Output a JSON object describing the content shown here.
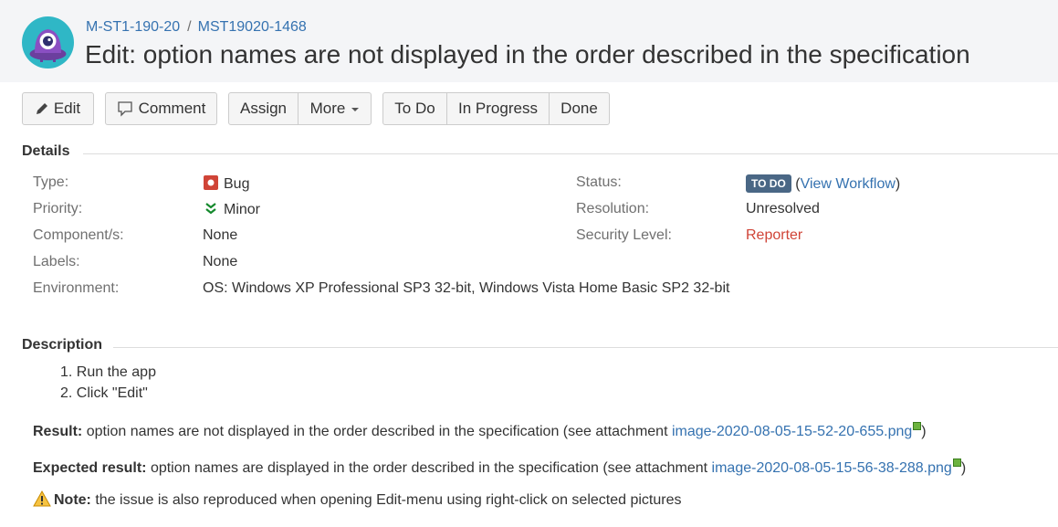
{
  "breadcrumb": {
    "project": "M-ST1-190-20",
    "separator": "/",
    "issue_key": "MST19020-1468"
  },
  "title": "Edit: option names are not displayed in the order described in the specification",
  "toolbar": {
    "edit": "Edit",
    "comment": "Comment",
    "assign": "Assign",
    "more": "More",
    "todo": "To Do",
    "in_progress": "In Progress",
    "done": "Done"
  },
  "details": {
    "heading": "Details",
    "type_label": "Type:",
    "type_value": "Bug",
    "priority_label": "Priority:",
    "priority_value": "Minor",
    "component_label": "Component/s:",
    "component_value": "None",
    "labels_label": "Labels:",
    "labels_value": "None",
    "environment_label": "Environment:",
    "environment_value": "OS: Windows XP Professional SP3 32-bit, Windows Vista Home Basic SP2 32-bit",
    "status_label": "Status:",
    "status_value": "TO DO",
    "status_paren_open": "(",
    "view_workflow": "View Workflow",
    "status_paren_close": ")",
    "resolution_label": "Resolution:",
    "resolution_value": "Unresolved",
    "security_label": "Security Level:",
    "security_value": "Reporter"
  },
  "description": {
    "heading": "Description",
    "steps": [
      "1. Run the app",
      "2. Click \"Edit\""
    ],
    "result_label": "Result:",
    "result_text": "option names are not displayed in the order described in the specification (see attachment",
    "result_link": "image-2020-08-05-15-52-20-655.png",
    "close_paren": ")",
    "expected_label": "Expected result:",
    "expected_text": "option names are displayed in the order described in the specification (see attachment",
    "expected_link": "image-2020-08-05-15-56-38-288.png",
    "note_label": "Note:",
    "note_text": "the issue is also reproduced when opening Edit-menu using right-click on selected pictures"
  },
  "colors": {
    "link": "#3572b0",
    "status_lozenge": "#4a6785",
    "security": "#d04437",
    "bug": "#d04437",
    "priority": "#14892c"
  },
  "icons": {
    "avatar": "project-avatar-icon",
    "bug": "bug-icon",
    "priority": "priority-minor-icon",
    "attachment": "attachment-icon",
    "warning": "warning-icon",
    "edit": "pencil-icon",
    "comment": "comment-icon"
  }
}
